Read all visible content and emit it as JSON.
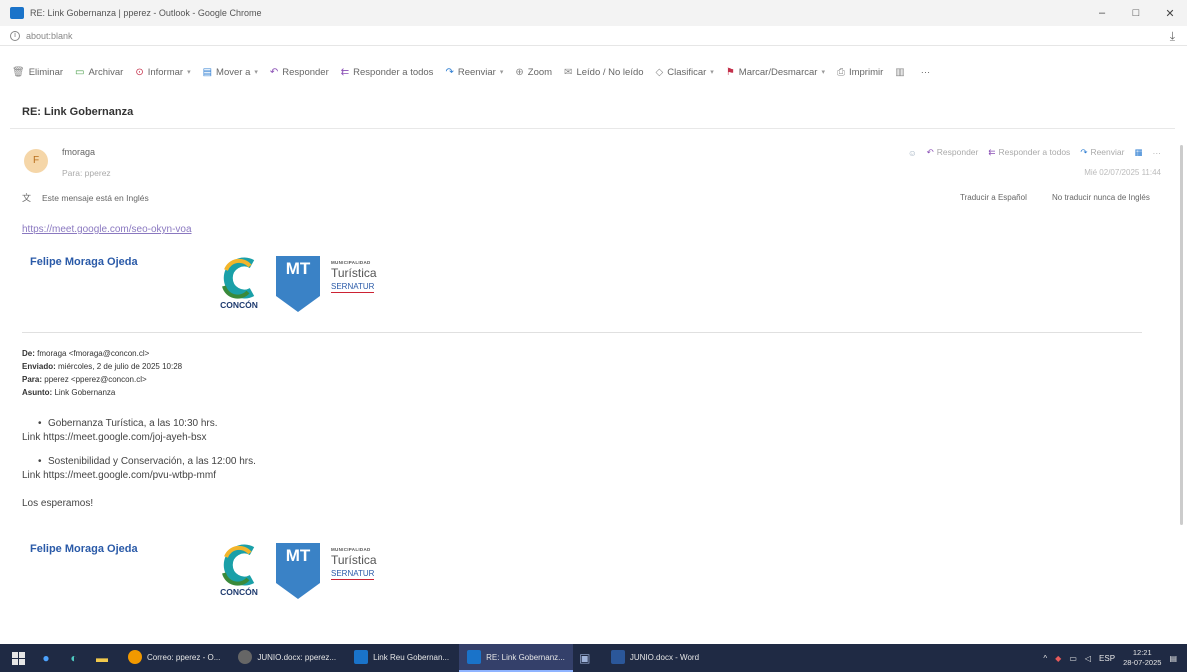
{
  "window": {
    "title": "RE: Link Gobernanza | pperez - Outlook - Google Chrome",
    "controls": [
      "–",
      "□",
      "✕"
    ]
  },
  "address": {
    "url": "about:blank"
  },
  "toolbar": {
    "eliminar": "Eliminar",
    "archivar": "Archivar",
    "informar": "Informar",
    "mover": "Mover a",
    "responder": "Responder",
    "responder_todos": "Responder a todos",
    "reenviar": "Reenviar",
    "zoom": "Zoom",
    "leido": "Leído / No leído",
    "clasificar": "Clasificar",
    "marcar": "Marcar/Desmarcar",
    "imprimir": "Imprimir",
    "more": "···"
  },
  "message": {
    "subject": "RE: Link Gobernanza",
    "avatar_initial": "F",
    "sender": "fmoraga",
    "to": "Para: pperez",
    "actions": {
      "responder": "Responder",
      "responder_todos": "Responder a todos",
      "reenviar": "Reenviar",
      "more": "···"
    },
    "date": "Mié 02/07/2025 11:44",
    "translate": {
      "notice": "Este mensaje está en Inglés",
      "translate_to": "Traducir a Español",
      "never": "No traducir nunca de Inglés"
    },
    "link": "https://meet.google.com/seo-okyn-voa"
  },
  "signature": {
    "name": "Felipe Moraga Ojeda",
    "concon": "CONCÓN",
    "mt": "MT",
    "muni": "MUNICIPALIDAD",
    "turistica": "Turística",
    "sernatur": "SERNATUR"
  },
  "quoted": {
    "de_label": "De:",
    "de": "fmoraga <fmoraga@concon.cl>",
    "enviado_label": "Enviado:",
    "enviado": "miércoles, 2 de julio de 2025 10:28",
    "para_label": "Para:",
    "para": "pperez <pperez@concon.cl>",
    "asunto_label": "Asunto:",
    "asunto": "Link Gobernanza",
    "item1": "Gobernanza Turística, a las 10:30 hrs.",
    "link1": "Link https://meet.google.com/joj-ayeh-bsx",
    "item2": "Sostenibilidad y Conservación, a las 12:00 hrs.",
    "link2": "Link https://meet.google.com/pvu-wtbp-mmf",
    "closing": "Los esperamos!"
  },
  "taskbar": {
    "apps": [
      {
        "label": "Correo: pperez - O...",
        "color": "#f29900"
      },
      {
        "label": "JUNIO.docx: pperez...",
        "color": "#4a4a4a"
      },
      {
        "label": "Link Reu Gobernan...",
        "color": "#1a73c9"
      },
      {
        "label": "RE: Link Gobernanz...",
        "color": "#1a73c9"
      },
      {
        "label": "JUNIO.docx - Word",
        "color": "#2b579a"
      }
    ],
    "lang": "ESP",
    "time": "12:21",
    "date": "28-07-2025"
  }
}
